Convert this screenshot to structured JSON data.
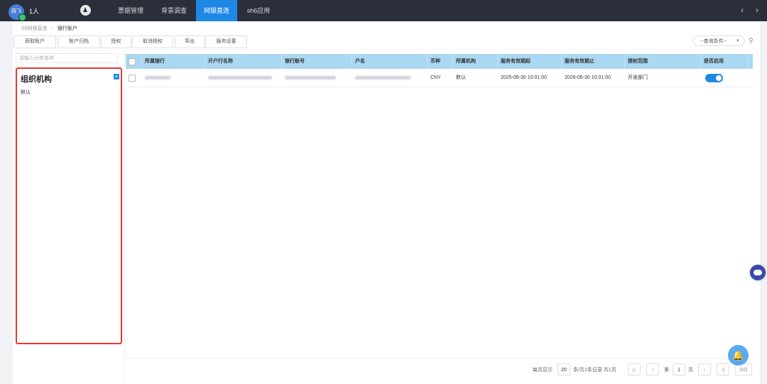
{
  "topbar": {
    "avatar_text": "燕飞",
    "user_name": "1人",
    "tabs": [
      {
        "label": "票据管理"
      },
      {
        "label": "背景调查"
      },
      {
        "label": "网银直连"
      },
      {
        "label": "sh6应用"
      }
    ],
    "active_tab": "网银直连",
    "prev_icon": "chevron-left-icon",
    "next_icon": "chevron-right-icon"
  },
  "breadcrumb": {
    "parent": "S8网银直连",
    "separator": "-",
    "current": "银行账户"
  },
  "toolbar": {
    "buttons": [
      "获取账户",
      "账户归档",
      "授权",
      "取消授权",
      "导出",
      "服务设置"
    ]
  },
  "query": {
    "select_value": "--查询条件--",
    "search_icon": "search-icon"
  },
  "tree": {
    "search_placeholder": "请输入分类名称",
    "title": "组织机构",
    "add_icon": "plus-square-icon",
    "nodes": [
      "默认"
    ]
  },
  "table": {
    "columns": [
      "所属银行",
      "开户行名称",
      "银行账号",
      "户名",
      "币种",
      "所属机构",
      "服务有效期起",
      "服务有效期止",
      "授权范围",
      "是否启用"
    ],
    "rows": [
      {
        "bank": "",
        "branch": "",
        "account_no": "",
        "account_name": "",
        "currency": "CNY",
        "org": "默认",
        "service_start": "2025-06-30 10:01:00",
        "service_end": "2026-06-30 10:01:00",
        "auth_scope": "开发部门",
        "enabled": true
      }
    ]
  },
  "pagination": {
    "per_page_label": "每页显示",
    "per_page": "20",
    "summary": "条/共1条记录 共1页",
    "page_label": "第",
    "current_page": "1",
    "page_suffix": "页",
    "go_label": "GO"
  },
  "colors": {
    "topbar_bg": "#2b2f3a",
    "accent": "#1e88e5",
    "table_header_bg": "#aad7f2",
    "highlight_border": "#e53935"
  }
}
